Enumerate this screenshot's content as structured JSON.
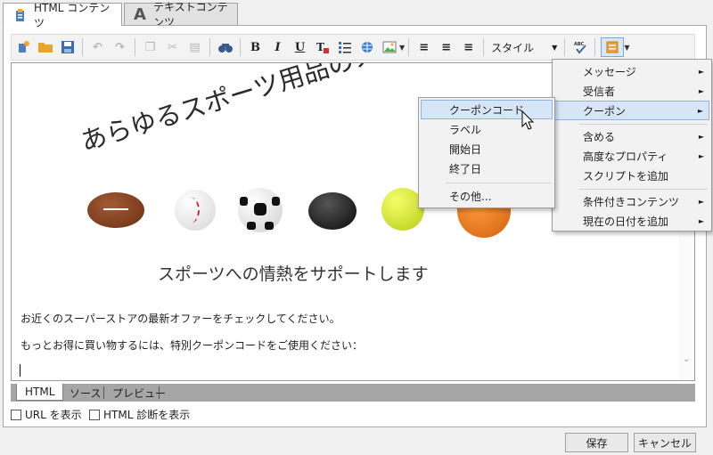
{
  "tabs": [
    {
      "label": "HTML コンテンツ",
      "icon": "html-content-icon",
      "active": true
    },
    {
      "label": "テキストコンテンツ",
      "icon": "text-content-icon",
      "active": false
    }
  ],
  "toolbar": {
    "style_label": "スタイル",
    "buttons": [
      "personalize-icon",
      "open-folder-icon",
      "save-icon",
      "undo-icon",
      "redo-icon",
      "copy-icon",
      "cut-icon",
      "paste-icon",
      "find-icon",
      "bold-icon",
      "italic-icon",
      "underline-icon",
      "text-color-icon",
      "list-icon",
      "link-icon",
      "image-icon",
      "align-left-icon",
      "align-center-icon",
      "align-right-icon",
      "style-select",
      "spellcheck-icon",
      "personalization-field-icon"
    ]
  },
  "editor": {
    "headline": "あらゆるスポーツ用品のメ",
    "subheadline": "スポーツへの情熱をサポートします",
    "paragraph1": "お近くのスーパーストアの最新オファーをチェックしてください。",
    "paragraph2": "もっとお得に買い物するには、特別クーポンコードをご使用ください：",
    "balls": [
      "football",
      "baseball",
      "soccer-ball",
      "hockey-puck",
      "tennis-ball",
      "basketball"
    ]
  },
  "modes": [
    "HTML",
    "ソース",
    "プレビュー"
  ],
  "checks": [
    "URL を表示",
    "HTML 診断を表示"
  ],
  "buttons": {
    "save": "保存",
    "cancel": "キャンセル"
  },
  "menu_main": [
    {
      "label": "メッセージ",
      "submenu": true
    },
    {
      "label": "受信者",
      "submenu": true
    },
    {
      "label": "クーポン",
      "submenu": true,
      "highlighted": true
    },
    {
      "label": "含める",
      "submenu": true
    },
    {
      "label": "高度なプロパティ",
      "submenu": true
    },
    {
      "label": "スクリプトを追加",
      "submenu": false
    },
    {
      "label": "条件付きコンテンツ",
      "submenu": true
    },
    {
      "label": "現在の日付を追加",
      "submenu": true
    }
  ],
  "menu_coupon": [
    {
      "label": "クーポンコード",
      "highlighted": true
    },
    {
      "label": "ラベル"
    },
    {
      "label": "開始日"
    },
    {
      "label": "終了日"
    },
    {
      "label": "その他..."
    }
  ],
  "colors": {
    "highlight": "#d7e6f6",
    "highlight_border": "#8eb3dd",
    "mode_bar": "#a6a6a6"
  }
}
